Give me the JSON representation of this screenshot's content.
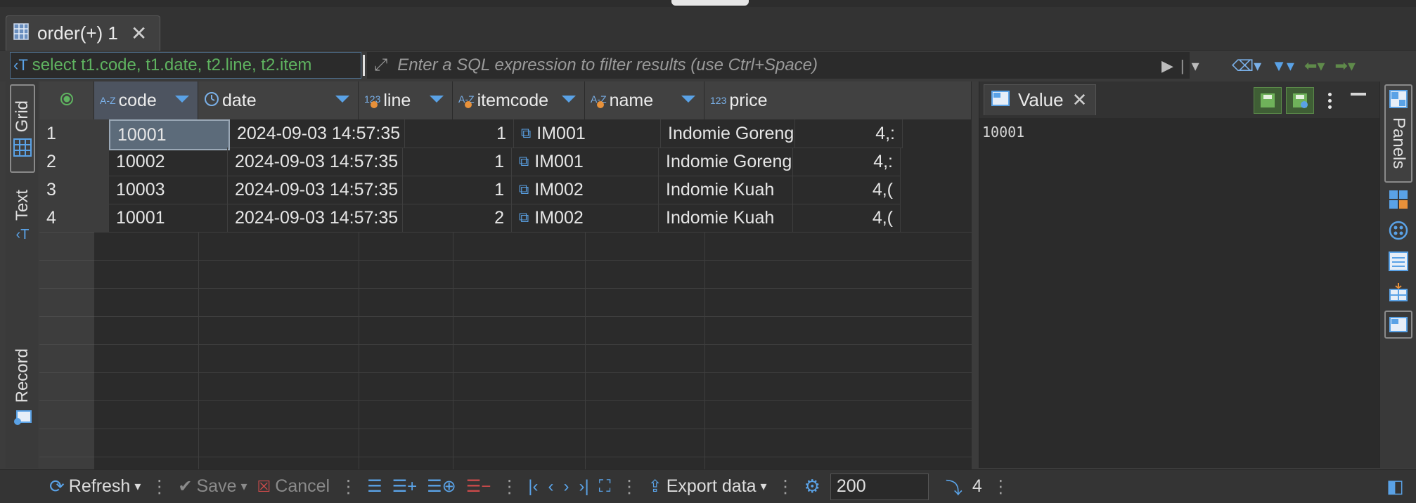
{
  "tab": {
    "label": "order(+) 1"
  },
  "filter": {
    "query_text": "select t1.code, t1.date, t2.line, t2.item",
    "placeholder": "Enter a SQL expression to filter results (use Ctrl+Space)"
  },
  "left_tabs": {
    "grid": "Grid",
    "text": "Text",
    "record": "Record"
  },
  "columns": [
    {
      "name": "code",
      "type_icon": "A-Z"
    },
    {
      "name": "date",
      "type_icon": "clock"
    },
    {
      "name": "line",
      "type_icon": "123"
    },
    {
      "name": "itemcode",
      "type_icon": "A-Z"
    },
    {
      "name": "name",
      "type_icon": "A-Z"
    },
    {
      "name": "price",
      "type_icon": "123"
    }
  ],
  "rows": [
    {
      "num": "1",
      "code": "10001",
      "date": "2024-09-03 14:57:35",
      "line": "1",
      "itemcode": "IM001",
      "name": "Indomie Goreng",
      "price": "4,:"
    },
    {
      "num": "2",
      "code": "10002",
      "date": "2024-09-03 14:57:35",
      "line": "1",
      "itemcode": "IM001",
      "name": "Indomie Goreng",
      "price": "4,:"
    },
    {
      "num": "3",
      "code": "10003",
      "date": "2024-09-03 14:57:35",
      "line": "1",
      "itemcode": "IM002",
      "name": "Indomie Kuah",
      "price": "4,("
    },
    {
      "num": "4",
      "code": "10001",
      "date": "2024-09-03 14:57:35",
      "line": "2",
      "itemcode": "IM002",
      "name": "Indomie Kuah",
      "price": "4,("
    }
  ],
  "value_panel": {
    "title": "Value",
    "content": "10001"
  },
  "right_sidebar": {
    "panels_label": "Panels"
  },
  "bottom": {
    "refresh": "Refresh",
    "save": "Save",
    "cancel": "Cancel",
    "export": "Export data",
    "limit": "200",
    "row_count": "4"
  },
  "colors": {
    "accent": "#5aa2e6",
    "query_text": "#5fb360",
    "selected_cell": "#5c6b7a"
  }
}
